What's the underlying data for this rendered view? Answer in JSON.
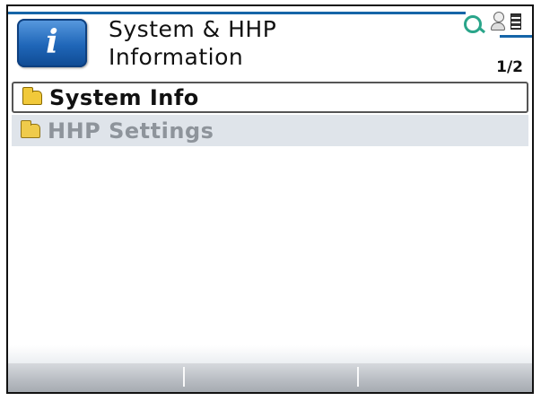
{
  "header": {
    "title_line1": "System & HHP",
    "title_line2": "Information",
    "icon_glyph": "i",
    "page_indicator": "1/2"
  },
  "status_icons": [
    "search-icon",
    "user-icon",
    "battery-icon"
  ],
  "menu": {
    "items": [
      {
        "label": "System Info",
        "icon": "folder-icon",
        "selected": true
      },
      {
        "label": "HHP Settings",
        "icon": "folder-icon",
        "selected": false
      }
    ]
  },
  "softkeys": [
    "",
    "",
    ""
  ],
  "colors": {
    "header_accent": "#1565a8",
    "selected_border": "#555555",
    "unselected_bg": "#dfe4ea",
    "folder": "#f1c93a"
  }
}
